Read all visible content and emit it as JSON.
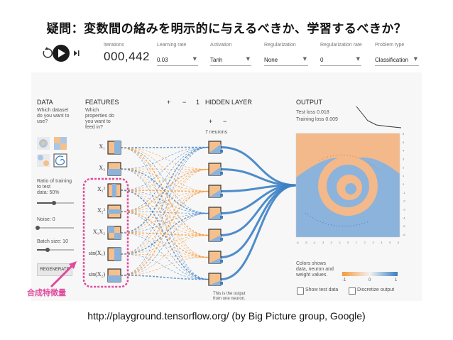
{
  "slide": {
    "title": "疑問：変数間の絡みを明示的に与えるべきか、学習するべきか？",
    "annotation": "合成特徴量",
    "footer": "http://playground.tensorflow.org/ (by Big Picture group, Google)"
  },
  "toolbar": {
    "iterations_label": "Iterations",
    "iterations_value": "000,442",
    "learning_rate_label": "Learning rate",
    "learning_rate_value": "0.03",
    "activation_label": "Activation",
    "activation_value": "Tanh",
    "regularization_label": "Regularization",
    "regularization_value": "None",
    "reg_rate_label": "Regularization rate",
    "reg_rate_value": "0",
    "problem_type_label": "Problem type",
    "problem_type_value": "Classification"
  },
  "data_panel": {
    "title": "DATA",
    "prompt": [
      "Which dataset",
      "do you want to",
      "use?"
    ],
    "ratio_label": [
      "Ratio of training",
      "to test",
      "data: 50%"
    ],
    "noise_label": "Noise: 0",
    "batch_label": "Batch size: 10",
    "regenerate_label": "REGENERATE"
  },
  "features_panel": {
    "title": "FEATURES",
    "prompt": [
      "Which",
      "properties do",
      "you want to",
      "feed in?"
    ],
    "features": [
      "X₁",
      "X₂",
      "X₁²",
      "X₂²",
      "X₁X₂",
      "sin(X₁)",
      "sin(X₂)"
    ]
  },
  "hidden": {
    "add_layer": "+",
    "remove_layer": "−",
    "layer_count": "1",
    "title": "HIDDEN LAYER",
    "add_neuron": "+",
    "remove_neuron": "−",
    "neurons_label": "7 neurons",
    "note": [
      "This is the output",
      "from one neuron."
    ]
  },
  "output": {
    "title": "OUTPUT",
    "test_loss": "Test loss 0.018",
    "training_loss": "Training loss 0.009",
    "colors_note": [
      "Colors shows",
      "data, neuron and",
      "weight values."
    ],
    "scale_min": "-1",
    "scale_mid": "0",
    "scale_max": "1",
    "show_test_label": "Show test data",
    "discretize_label": "Discretize output",
    "axis_ticks": [
      "-6",
      "-5",
      "-4",
      "-3",
      "-2",
      "-1",
      "0",
      "1",
      "2",
      "3",
      "4",
      "5",
      "6"
    ]
  },
  "colors": {
    "orange": "#f59a3c",
    "blue": "#3b7fc4",
    "highlight": "#e04b9e"
  }
}
